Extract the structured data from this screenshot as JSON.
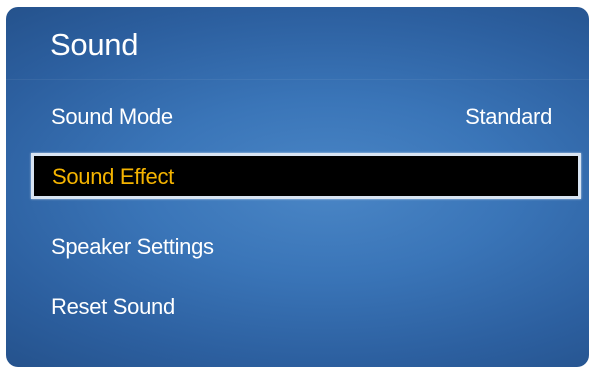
{
  "menu": {
    "title": "Sound",
    "items": [
      {
        "label": "Sound Mode",
        "value": "Standard"
      },
      {
        "label": "Sound Effect"
      },
      {
        "label": "Speaker Settings"
      },
      {
        "label": "Reset Sound"
      }
    ],
    "selected_index": 1
  },
  "colors": {
    "panel_blue": "#3a75b8",
    "highlight_background": "#000000",
    "highlight_text": "#f5b400",
    "highlight_border": "#d8e4f2",
    "text": "#ffffff"
  }
}
